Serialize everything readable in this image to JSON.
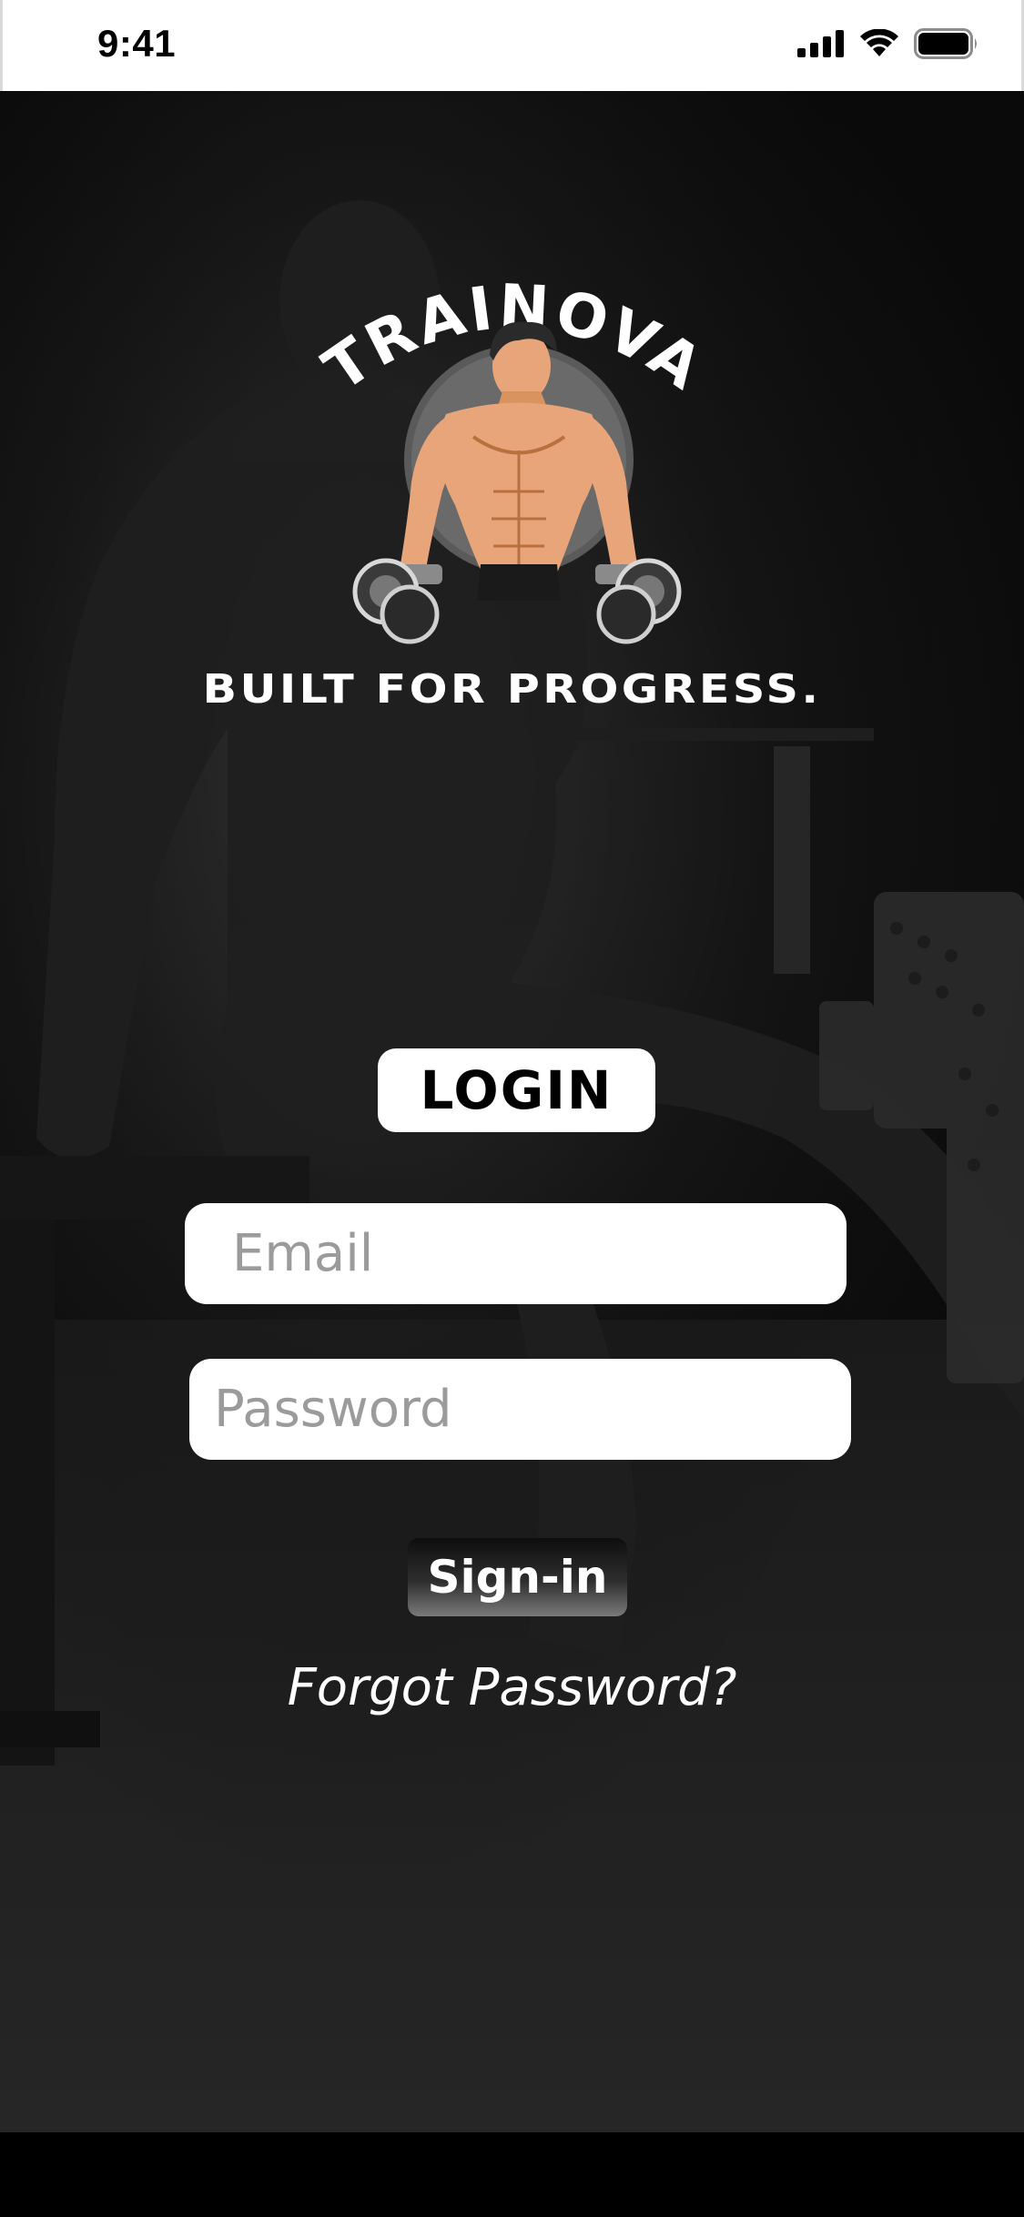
{
  "status_bar": {
    "time": "9:41",
    "signal_icon": "cellular-signal-icon",
    "wifi_icon": "wifi-icon",
    "battery_icon": "battery-icon"
  },
  "brand": {
    "logo_text": "TRAINOVA",
    "logo_icon": "bodybuilder-dumbbells-illustration",
    "tagline": "BUILT FOR PROGRESS."
  },
  "login": {
    "heading": "LOGIN",
    "email_placeholder": "Email",
    "email_value": "",
    "password_placeholder": "Password",
    "password_value": "",
    "signin_label": "Sign-in",
    "forgot_label": "Forgot Password?"
  },
  "colors": {
    "background": "#0a0a0a",
    "accent_skin": "#e8a57a",
    "text_light": "#ffffff",
    "placeholder": "#9b9b9b"
  }
}
